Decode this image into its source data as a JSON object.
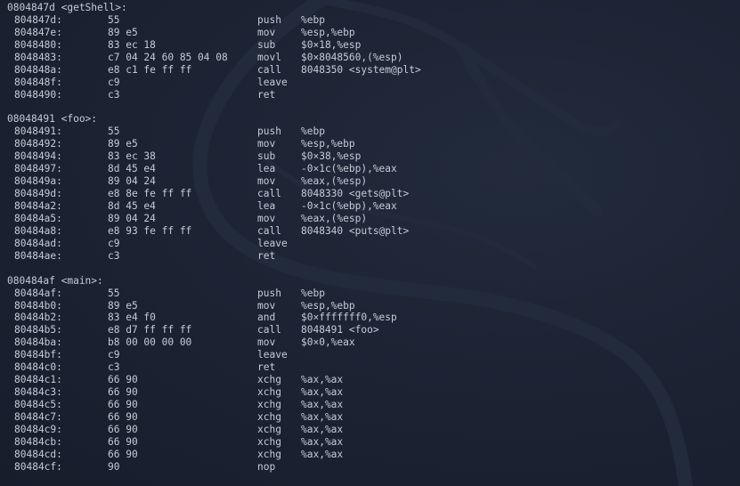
{
  "colors": {
    "background": "#1a2130",
    "text": "#c6ccd6",
    "watermark": "#232c3d"
  },
  "watermark_icon": "kali-dragon-icon",
  "blocks": [
    {
      "label": "0804847d <getShell>:",
      "lines": [
        {
          "addr": "804847d:",
          "bytes": "55",
          "mnemonic": "push",
          "operands": "%ebp"
        },
        {
          "addr": "804847e:",
          "bytes": "89 e5",
          "mnemonic": "mov",
          "operands": "%esp,%ebp"
        },
        {
          "addr": "8048480:",
          "bytes": "83 ec 18",
          "mnemonic": "sub",
          "operands": "$0×18,%esp"
        },
        {
          "addr": "8048483:",
          "bytes": "c7 04 24 60 85 04 08",
          "mnemonic": "movl",
          "operands": "$0×8048560,(%esp)"
        },
        {
          "addr": "804848a:",
          "bytes": "e8 c1 fe ff ff",
          "mnemonic": "call",
          "operands": "8048350 <system@plt>"
        },
        {
          "addr": "804848f:",
          "bytes": "c9",
          "mnemonic": "leave",
          "operands": ""
        },
        {
          "addr": "8048490:",
          "bytes": "c3",
          "mnemonic": "ret",
          "operands": ""
        }
      ]
    },
    {
      "label": "08048491 <foo>:",
      "lines": [
        {
          "addr": "8048491:",
          "bytes": "55",
          "mnemonic": "push",
          "operands": "%ebp"
        },
        {
          "addr": "8048492:",
          "bytes": "89 e5",
          "mnemonic": "mov",
          "operands": "%esp,%ebp"
        },
        {
          "addr": "8048494:",
          "bytes": "83 ec 38",
          "mnemonic": "sub",
          "operands": "$0×38,%esp"
        },
        {
          "addr": "8048497:",
          "bytes": "8d 45 e4",
          "mnemonic": "lea",
          "operands": "-0×1c(%ebp),%eax"
        },
        {
          "addr": "804849a:",
          "bytes": "89 04 24",
          "mnemonic": "mov",
          "operands": "%eax,(%esp)"
        },
        {
          "addr": "804849d:",
          "bytes": "e8 8e fe ff ff",
          "mnemonic": "call",
          "operands": "8048330 <gets@plt>"
        },
        {
          "addr": "80484a2:",
          "bytes": "8d 45 e4",
          "mnemonic": "lea",
          "operands": "-0×1c(%ebp),%eax"
        },
        {
          "addr": "80484a5:",
          "bytes": "89 04 24",
          "mnemonic": "mov",
          "operands": "%eax,(%esp)"
        },
        {
          "addr": "80484a8:",
          "bytes": "e8 93 fe ff ff",
          "mnemonic": "call",
          "operands": "8048340 <puts@plt>"
        },
        {
          "addr": "80484ad:",
          "bytes": "c9",
          "mnemonic": "leave",
          "operands": ""
        },
        {
          "addr": "80484ae:",
          "bytes": "c3",
          "mnemonic": "ret",
          "operands": ""
        }
      ]
    },
    {
      "label": "080484af <main>:",
      "lines": [
        {
          "addr": "80484af:",
          "bytes": "55",
          "mnemonic": "push",
          "operands": "%ebp"
        },
        {
          "addr": "80484b0:",
          "bytes": "89 e5",
          "mnemonic": "mov",
          "operands": "%esp,%ebp"
        },
        {
          "addr": "80484b2:",
          "bytes": "83 e4 f0",
          "mnemonic": "and",
          "operands": "$0×fffffff0,%esp"
        },
        {
          "addr": "80484b5:",
          "bytes": "e8 d7 ff ff ff",
          "mnemonic": "call",
          "operands": "8048491 <foo>"
        },
        {
          "addr": "80484ba:",
          "bytes": "b8 00 00 00 00",
          "mnemonic": "mov",
          "operands": "$0×0,%eax"
        },
        {
          "addr": "80484bf:",
          "bytes": "c9",
          "mnemonic": "leave",
          "operands": ""
        },
        {
          "addr": "80484c0:",
          "bytes": "c3",
          "mnemonic": "ret",
          "operands": ""
        },
        {
          "addr": "80484c1:",
          "bytes": "66 90",
          "mnemonic": "xchg",
          "operands": "%ax,%ax"
        },
        {
          "addr": "80484c3:",
          "bytes": "66 90",
          "mnemonic": "xchg",
          "operands": "%ax,%ax"
        },
        {
          "addr": "80484c5:",
          "bytes": "66 90",
          "mnemonic": "xchg",
          "operands": "%ax,%ax"
        },
        {
          "addr": "80484c7:",
          "bytes": "66 90",
          "mnemonic": "xchg",
          "operands": "%ax,%ax"
        },
        {
          "addr": "80484c9:",
          "bytes": "66 90",
          "mnemonic": "xchg",
          "operands": "%ax,%ax"
        },
        {
          "addr": "80484cb:",
          "bytes": "66 90",
          "mnemonic": "xchg",
          "operands": "%ax,%ax"
        },
        {
          "addr": "80484cd:",
          "bytes": "66 90",
          "mnemonic": "xchg",
          "operands": "%ax,%ax"
        },
        {
          "addr": "80484cf:",
          "bytes": "90",
          "mnemonic": "nop",
          "operands": ""
        }
      ]
    }
  ]
}
